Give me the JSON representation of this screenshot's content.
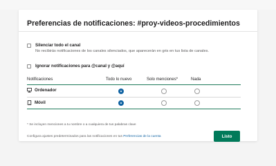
{
  "dialog": {
    "title": "Preferencias de notificaciones: #proy-videos-procedimientos"
  },
  "options": {
    "mute_label": "Silenciar todo el canal",
    "mute_desc": "No recibirás notificaciones de los canales silenciados, que aparecerán en gris en tus lista de canales.",
    "ignore_label": "Ignorar notificaciones para @canal y @aquí"
  },
  "table": {
    "headers": [
      "Notificaciones",
      "Todo lo nuevo",
      "Solo menciones*",
      "Nada"
    ],
    "rows": [
      {
        "label": "Ordenador",
        "icon": "desktop-icon",
        "selected": "Todo lo nuevo"
      },
      {
        "label": "Móvil",
        "icon": "mobile-icon",
        "selected": "Todo lo nuevo"
      }
    ]
  },
  "footnote": "* Se incluyen menciones a tu nombre o a cualquiera de tus palabras clave",
  "footer": {
    "text": "Configura ajustes predeterminados para las notificaciones en tus ",
    "link": "Preferencias de la cuenta"
  },
  "actions": {
    "done_label": "Listo"
  },
  "colors": {
    "accent": "#007a5a",
    "radio_selected": "#1264a3",
    "link": "#1264a3"
  }
}
